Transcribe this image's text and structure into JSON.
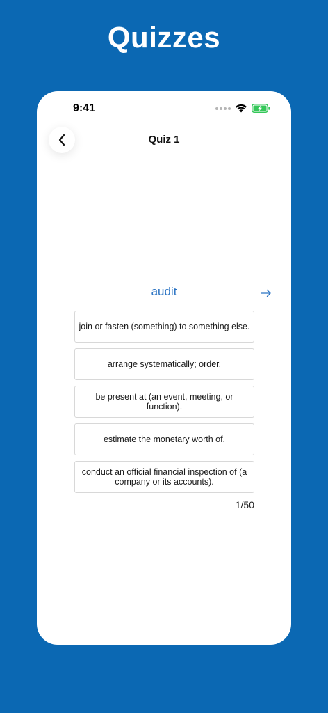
{
  "headline": "Quizzes",
  "status_bar": {
    "time": "9:41"
  },
  "nav": {
    "title": "Quiz 1"
  },
  "quiz": {
    "word": "audit",
    "options": [
      {
        "text": "join or fasten (something) to something else."
      },
      {
        "text": "arrange systematically; order."
      },
      {
        "text": "be present at (an event, meeting, or function)."
      },
      {
        "text": "estimate the monetary worth of."
      },
      {
        "text": "conduct an official financial inspection of (a company or its accounts)."
      }
    ],
    "progress": "1/50"
  },
  "colors": {
    "background": "#0b68b3",
    "accent": "#2a73c3",
    "battery": "#34c759"
  },
  "icons": [
    "signal-dots-icon",
    "wifi-icon",
    "battery-charging-icon",
    "chevron-left-icon",
    "arrow-right-icon"
  ]
}
